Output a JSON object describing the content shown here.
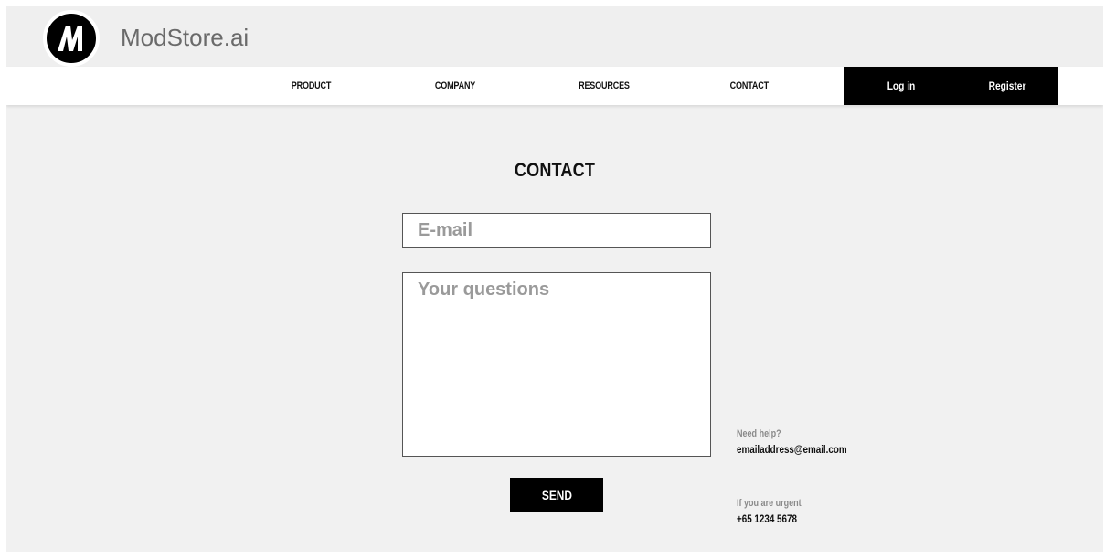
{
  "brand": {
    "logo_icon": "modstore-m-logo-icon",
    "name": "ModStore.ai"
  },
  "nav": {
    "items": [
      {
        "label": "PRODUCT"
      },
      {
        "label": "COMPANY"
      },
      {
        "label": "RESOURCES"
      },
      {
        "label": "CONTACT"
      }
    ],
    "auth": {
      "login_label": "Log in",
      "register_label": "Register"
    }
  },
  "contact": {
    "title": "CONTACT",
    "email_placeholder": "E-mail",
    "email_value": "",
    "questions_placeholder": "Your questions",
    "questions_value": "",
    "send_label": "SEND"
  },
  "info": {
    "help_label": "Need help?",
    "help_email": "emailaddress@email.com",
    "urgent_label": "If you are urgent",
    "urgent_phone": "+65 1234 5678"
  },
  "colors": {
    "background": "#f1f1f1",
    "accent": "#000000",
    "muted_text": "#8a8a8a"
  }
}
